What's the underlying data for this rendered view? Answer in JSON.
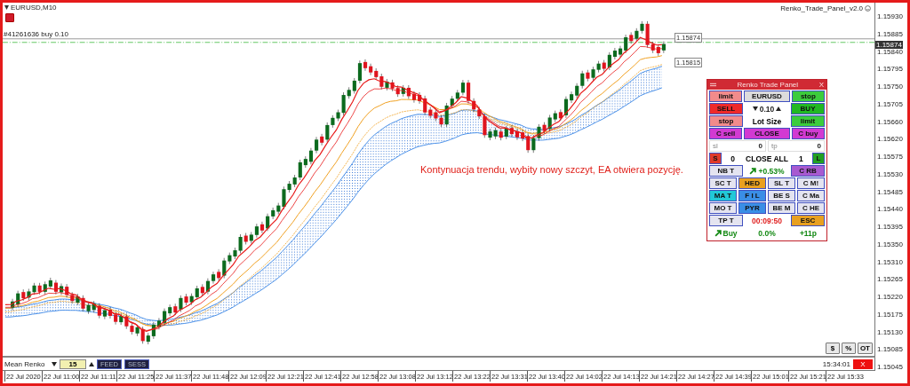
{
  "chart": {
    "symbol": "EURUSD,M10",
    "expert_name": "Renko_Trade_Panel_v2.0",
    "order_line_label": "#41261636 buy 0.10",
    "price_tags": [
      "1.15874",
      "1.15815"
    ],
    "annotation": "Kontynuacja trendu, wybity nowy szczyt, EA otwiera pozycję.",
    "corner_buttons": [
      "$",
      "%",
      "OT"
    ]
  },
  "trade_panel": {
    "title": "Renko Trade Panel",
    "close": "X",
    "rows": [
      [
        {
          "kind": "button",
          "text": "limit",
          "color": "#f28b8b"
        },
        {
          "kind": "button",
          "text": "EURUSD",
          "color": "#dcdcdc"
        },
        {
          "kind": "button",
          "text": "stop",
          "color": "#3ccc3c"
        }
      ],
      [
        {
          "kind": "button",
          "text": "SELL",
          "color": "#ee2a2a"
        },
        {
          "kind": "stepper",
          "text": "0.10",
          "color": "#ffffff"
        },
        {
          "kind": "button",
          "text": "BUY",
          "color": "#22b822"
        }
      ],
      [
        {
          "kind": "button",
          "text": "stop",
          "color": "#f28b8b"
        },
        {
          "kind": "label",
          "text": "Lot Size",
          "color": "#000000"
        },
        {
          "kind": "button",
          "text": "limit",
          "color": "#3ccc3c"
        }
      ],
      [
        {
          "kind": "button",
          "text": "C sell",
          "color": "#d23ad2"
        },
        {
          "kind": "button",
          "text": "CLOSE",
          "color": "#d23ad2"
        },
        {
          "kind": "button",
          "text": "C buy",
          "color": "#d23ad2"
        }
      ],
      [
        {
          "kind": "field",
          "text": "sl",
          "value": "0",
          "color": "#ffffff"
        },
        {
          "kind": "field",
          "text": "tp",
          "value": "0",
          "color": "#ffffff"
        }
      ],
      [
        {
          "kind": "counter",
          "button": "S",
          "text": "0",
          "color": "#e03a2a"
        },
        {
          "kind": "label",
          "text": "CLOSE ALL",
          "color": "#000000"
        },
        {
          "kind": "counter",
          "button": "L",
          "text": "1",
          "color": "#22a022"
        }
      ],
      [
        {
          "kind": "button",
          "text": "NB T",
          "color": "#e4e4f0"
        },
        {
          "kind": "trend",
          "text": "+0.53%",
          "color": "#118811"
        },
        {
          "kind": "button",
          "text": "C RB",
          "color": "#a85ad0"
        }
      ],
      [
        {
          "kind": "button",
          "text": "SC T",
          "color": "#e4e4f0"
        },
        {
          "kind": "button",
          "text": "HED",
          "color": "#e8a020"
        },
        {
          "kind": "button",
          "text": "SL T",
          "color": "#e4e4f0"
        },
        {
          "kind": "button",
          "text": "C M!",
          "color": "#e4e4f0"
        }
      ],
      [
        {
          "kind": "button",
          "text": "MA T",
          "color": "#22c8d8"
        },
        {
          "kind": "button",
          "text": "F I L",
          "color": "#3a8ee6"
        },
        {
          "kind": "button",
          "text": "BE S",
          "color": "#e4e4f0"
        },
        {
          "kind": "button",
          "text": "C Ma",
          "color": "#e4e4f0"
        }
      ],
      [
        {
          "kind": "button",
          "text": "MO T",
          "color": "#e4e4f0"
        },
        {
          "kind": "button",
          "text": "PYR",
          "color": "#3a8ee6"
        },
        {
          "kind": "button",
          "text": "BE M",
          "color": "#e4e4f0"
        },
        {
          "kind": "button",
          "text": "C HE",
          "color": "#e4e4f0"
        }
      ],
      [
        {
          "kind": "button",
          "text": "TP T",
          "color": "#e4e4f0"
        },
        {
          "kind": "label",
          "text": "00:09:50",
          "color": "#e02020"
        },
        {
          "kind": "button",
          "text": "ESC",
          "color": "#e8a020"
        }
      ],
      [
        {
          "kind": "trend",
          "text": "Buy",
          "color": "#118811"
        },
        {
          "kind": "label",
          "text": "0.0%",
          "color": "#118811"
        },
        {
          "kind": "label",
          "text": "+11p",
          "color": "#118811"
        }
      ]
    ]
  },
  "indicator_pane": {
    "name": "Mean Renko",
    "period": "15",
    "buttons": [
      "FEED",
      "SESS"
    ],
    "server_time": "15:34:01",
    "close": "X"
  },
  "price_axis": {
    "current_price": "1.15874",
    "labels": [
      "1.15930",
      "1.15885",
      "1.15840",
      "1.15795",
      "1.15750",
      "1.15705",
      "1.15660",
      "1.15620",
      "1.15575",
      "1.15530",
      "1.15485",
      "1.15440",
      "1.15395",
      "1.15350",
      "1.15310",
      "1.15265",
      "1.15220",
      "1.15175",
      "1.15130",
      "1.15085",
      "1.15045"
    ]
  },
  "time_axis": [
    "22 Jul 2020",
    "22 Jul 11:00",
    "22 Jul 11:11",
    "22 Jul 11:25",
    "22 Jul 11:37",
    "22 Jul 11:48",
    "22 Jul 12:09",
    "22 Jul 12:21",
    "22 Jul 12:41",
    "22 Jul 12:58",
    "22 Jul 13:08",
    "22 Jul 13:12",
    "22 Jul 13:22",
    "22 Jul 13:31",
    "22 Jul 13:40",
    "22 Jul 14:02",
    "22 Jul 14:13",
    "22 Jul 14:21",
    "22 Jul 14:27",
    "22 Jul 14:39",
    "22 Jul 15:01",
    "22 Jul 15:21",
    "22 Jul 15:33"
  ]
}
